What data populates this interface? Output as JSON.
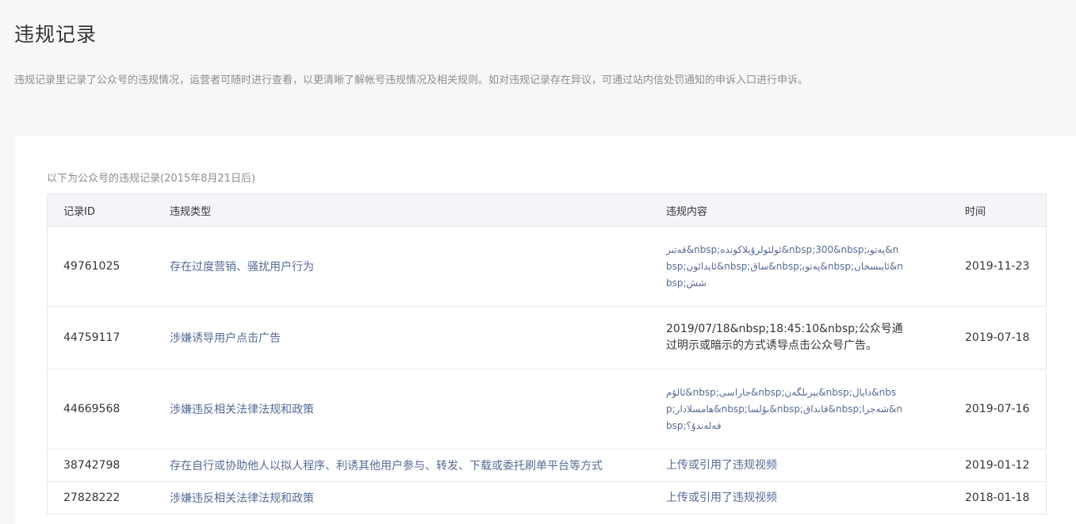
{
  "header": {
    "title": "违规记录",
    "description": "违规记录里记录了公众号的违规情况，运营者可随时进行查看，以更清晰了解帐号违规情况及相关规则。如对违规记录存在异议，可通过站内信处罚通知的申诉入口进行申诉。"
  },
  "records_section": {
    "caption": "以下为公众号的违规记录(2015年8月21日后)",
    "columns": {
      "id": "记录ID",
      "type": "违规类型",
      "content": "违规内容",
      "time": "时间"
    },
    "rows": [
      {
        "id": "49761025",
        "type": "存在过度营销、骚扰用户行为",
        "content": "ﻗﻪﺗﯩﺮ&nbsp;ﺋﻮﻟﺌﻮﻟﺮﯗﻳﻼﻛﻮﻧﺪﻩ&nbsp;300&nbsp;ﭘﻪﺗﻮﺑ&nbsp;ﺋﺎﻳﺪﺍﺋﻮﻥ&nbsp;ﺳﺎﻕ&nbsp;ﭘﻪﺗﻮﺑ&nbsp;ﺋﺎﻳﯩﺴﺨﺎﻥ&nbsp;ﺷﺶ",
        "time": "2019-11-23"
      },
      {
        "id": "44759117",
        "type": "涉嫌诱导用户点击广告",
        "content": "2019/07/18&nbsp;18:45:10&nbsp;公众号通过明示或暗示的方式诱导点击公众号广告。",
        "time": "2019-07-18"
      },
      {
        "id": "44669568",
        "type": "涉嫌违反相关法律法规和政策",
        "content": "ﺋﺎﻟﯘﻡ&nbsp;ﺟﺎﺭﺍﺳﻰ&nbsp;ﺑﯧﺮﯨﻠﮕﻪﻥ&nbsp;ﺩﺍﻳﺎﻝ&nbsp;ﮬﺎﻣﺴﻼﺩﺍﺭ&nbsp;ﺑﯘﻟﺴﺎ&nbsp;ﻗﺎﻧﺪﺍﻕ&nbsp;ﺷﻪﺟﺮﺍ&nbsp;ﻓﻪﻟﻪﻧﺪﯗ؟",
        "time": "2019-07-16"
      },
      {
        "id": "38742798",
        "type": "存在自行或协助他人以拟人程序、利诱其他用户参与、转发、下载或委托刷单平台等方式",
        "content": "上传或引用了违规视频",
        "time": "2019-01-12"
      },
      {
        "id": "27828222",
        "type": "涉嫌违反相关法律法规和政策",
        "content": "上传或引用了违规视频",
        "time": "2018-01-18"
      }
    ]
  },
  "colors": {
    "page_bg": "#f6f7f9",
    "card_bg": "#ffffff",
    "link_text": "#576b95",
    "muted_text": "#8d8d8d",
    "table_header_bg": "#f4f5f9",
    "border": "#e7e7eb"
  }
}
